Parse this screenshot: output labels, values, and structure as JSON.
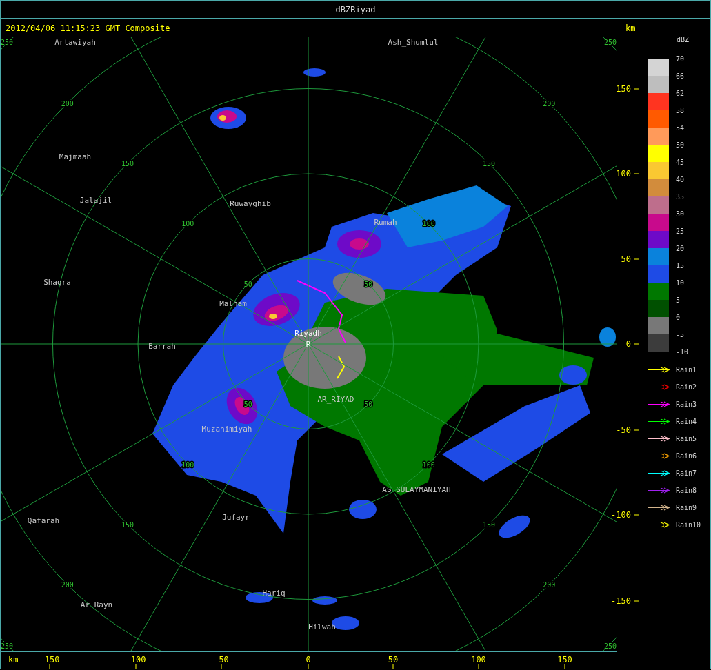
{
  "window": {
    "title": "dBZRiyad"
  },
  "header": {
    "timestamp": "2012/04/06 11:15:23 GMT Composite",
    "unit": "km"
  },
  "range_labels": {
    "nw": [
      "250",
      "200",
      "150",
      "100",
      "50"
    ],
    "ne": [
      "250",
      "200",
      "150",
      "100",
      "50"
    ],
    "sw": [
      "250",
      "200",
      "150",
      "100",
      "50"
    ],
    "se": [
      "250",
      "200",
      "150",
      "100",
      "50"
    ]
  },
  "places": [
    {
      "name": "Artawiyah",
      "kind": "city"
    },
    {
      "name": "Ash_Shumlul",
      "kind": "city"
    },
    {
      "name": "Majmaah",
      "kind": "city"
    },
    {
      "name": "Jalajil",
      "kind": "city"
    },
    {
      "name": "Ruwayghib",
      "kind": "city"
    },
    {
      "name": "Rumah",
      "kind": "city"
    },
    {
      "name": "Shaqra",
      "kind": "city"
    },
    {
      "name": "Malham",
      "kind": "city"
    },
    {
      "name": "Riyadh",
      "kind": "site"
    },
    {
      "name": "R",
      "kind": "site"
    },
    {
      "name": "Barrah",
      "kind": "city"
    },
    {
      "name": "AR_RIYAD",
      "kind": "city"
    },
    {
      "name": "Muzahimiyah",
      "kind": "city"
    },
    {
      "name": "AS_SULAYMANIYAH",
      "kind": "city"
    },
    {
      "name": "Qafarah",
      "kind": "city"
    },
    {
      "name": "Jufayr",
      "kind": "city"
    },
    {
      "name": "Hariq",
      "kind": "city"
    },
    {
      "name": "Ar_Rayn",
      "kind": "city"
    },
    {
      "name": "Hilwah",
      "kind": "city"
    }
  ],
  "x_axis": {
    "unit": "km",
    "ticks": [
      "-150",
      "-100",
      "-50",
      "0",
      "50",
      "100",
      "150"
    ]
  },
  "y_axis": {
    "ticks": [
      "150",
      "100",
      "50",
      "0",
      "-50",
      "-100",
      "-150"
    ]
  },
  "legend": {
    "title": "dBZ",
    "bands": [
      {
        "color": "#d4d4d4"
      },
      {
        "color": "#bebebe"
      },
      {
        "color": "#ff3420"
      },
      {
        "color": "#ff5a00"
      },
      {
        "color": "#ff9a5a"
      },
      {
        "color": "#ffff00"
      },
      {
        "color": "#fac832"
      },
      {
        "color": "#d28c3c"
      },
      {
        "color": "#be6e8c"
      },
      {
        "color": "#c80a8c"
      },
      {
        "color": "#6e0ac8"
      },
      {
        "color": "#0a82dc"
      },
      {
        "color": "#1e4be6"
      },
      {
        "color": "#007800"
      },
      {
        "color": "#005000"
      },
      {
        "color": "#787878"
      },
      {
        "color": "#3c3c3c"
      }
    ],
    "labels": [
      "70",
      "66",
      "62",
      "58",
      "54",
      "50",
      "45",
      "40",
      "35",
      "30",
      "25",
      "20",
      "15",
      "10",
      "5",
      "0",
      "-5",
      "-10"
    ]
  },
  "tracks": [
    {
      "label": "Rain1",
      "color": "#ffff00"
    },
    {
      "label": "Rain2",
      "color": "#ff0000"
    },
    {
      "label": "Rain3",
      "color": "#ff00ff"
    },
    {
      "label": "Rain4",
      "color": "#00ff00"
    },
    {
      "label": "Rain5",
      "color": "#ffc0cb"
    },
    {
      "label": "Rain6",
      "color": "#ffa500"
    },
    {
      "label": "Rain7",
      "color": "#00ffff"
    },
    {
      "label": "Rain8",
      "color": "#a020f0"
    },
    {
      "label": "Rain9",
      "color": "#d2b48c"
    },
    {
      "label": "Rain10",
      "color": "#ffff00"
    }
  ]
}
